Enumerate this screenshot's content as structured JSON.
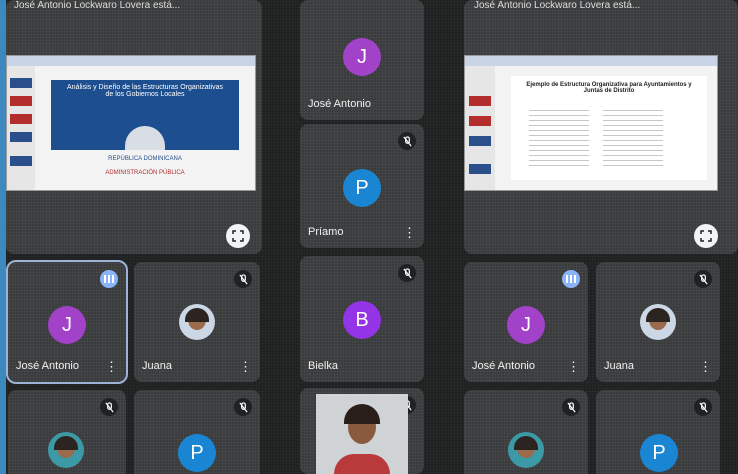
{
  "presentation_left": {
    "header": "José Antonio Lockwaro Lovera está...",
    "slide_title": "Análisis y Diseño de las Estructuras Organizativas de los Gobiernos Locales",
    "slide_org": "REPÚBLICA DOMINICANA",
    "slide_footer": "ADMINISTRACIÓN PÚBLICA"
  },
  "presentation_right": {
    "header": "José Antonio Lockwaro Lovera está...",
    "slide_title": "Ejemplo de Estructura Organizativa para Ayuntamientos y Juntas de Distrito"
  },
  "participants": [
    {
      "name": "José Antonio",
      "initial": "J",
      "color": "#a142c8"
    },
    {
      "name": "Príamo",
      "initial": "P",
      "color": "#1a86d3"
    },
    {
      "name": "José Antonio",
      "initial": "J",
      "color": "#a142c8"
    },
    {
      "name": "Juana",
      "initial": "",
      "color": "#cbd7e4"
    },
    {
      "name": "Bielka",
      "initial": "B",
      "color": "#9334e6"
    },
    {
      "name": "José Antonio",
      "initial": "J",
      "color": "#a142c8"
    },
    {
      "name": "Juana",
      "initial": "",
      "color": "#cbd7e4"
    },
    {
      "name": "",
      "initial": "P",
      "color": "#1a86d3"
    },
    {
      "name": "",
      "initial": "P",
      "color": "#1a86d3"
    }
  ],
  "icons": {
    "mute": "mic-off-icon",
    "more": "more-vert-icon",
    "fullscreen": "fullscreen-icon",
    "speaking": "audio-level-icon"
  }
}
